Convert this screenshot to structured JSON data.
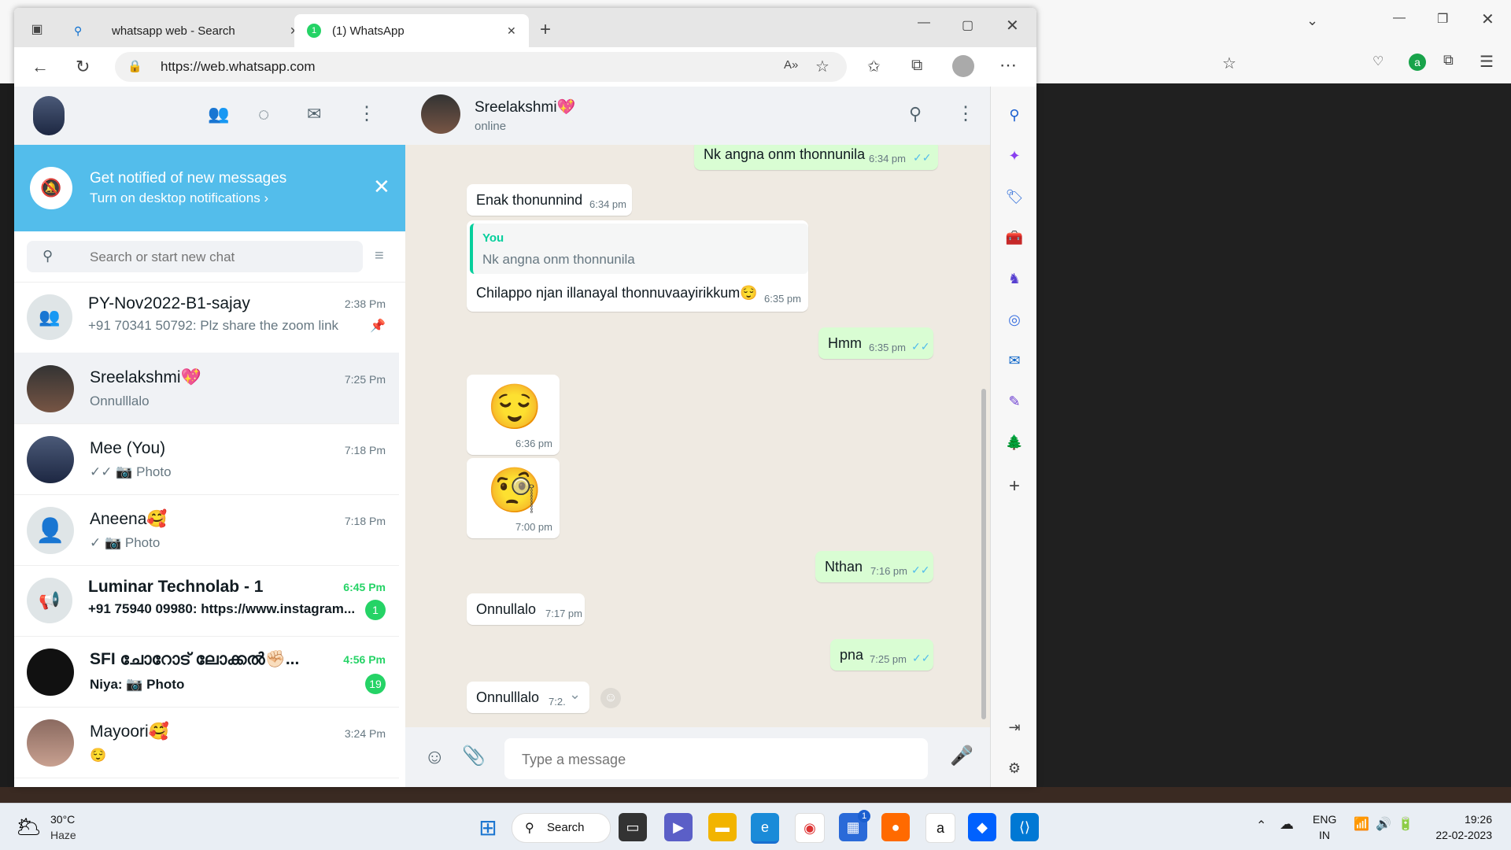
{
  "browser": {
    "tabs": [
      {
        "title": "whatsapp web - Search"
      },
      {
        "title": "(1) WhatsApp",
        "favicon_badge": "1"
      }
    ],
    "url": "https://web.whatsapp.com"
  },
  "notification": {
    "title": "Get notified of new messages",
    "subtitle": "Turn on desktop notifications ›"
  },
  "search": {
    "placeholder": "Search or start new chat"
  },
  "chats": [
    {
      "name": "PY-Nov2022-B1-sajay",
      "message": "+91 70341 50792: Plz share the zoom link",
      "time": "2:38 Pm"
    },
    {
      "name": "Sreelakshmi💖",
      "message": "Onnulllalo",
      "time": "7:25 Pm"
    },
    {
      "name": "Mee (You)",
      "message": "✓✓ 📷 Photo",
      "time": "7:18 Pm"
    },
    {
      "name": "Aneena🥰",
      "message": "✓ 📷 Photo",
      "time": "7:18 Pm"
    },
    {
      "name": "Luminar Technolab - 1",
      "message": "+91 75940 09980: https://www.instagram...",
      "time": "6:45 Pm",
      "badge": "1"
    },
    {
      "name": "SFI ചോറോട് ലോക്കൽ✊🏻...",
      "message": "Niya: 📷 Photo",
      "time": "4:56 Pm",
      "badge": "19"
    },
    {
      "name": "Mayoori🥰",
      "message": "😌",
      "time": "3:24 Pm"
    }
  ],
  "contact": {
    "name": "Sreelakshmi💖",
    "status": "online"
  },
  "messages": [
    {
      "text": "Nk angna onm thonnunila",
      "time": "6:34 pm"
    },
    {
      "text": "Enak thonunnind",
      "time": "6:34 pm"
    },
    {
      "quote_author": "You",
      "quote_text": "Nk angna onm thonnunila",
      "text": "Chilappo njan illanayal thonnuvaayirikkum😌",
      "time": "6:35 pm"
    },
    {
      "text": "Hmm",
      "time": "6:35 pm"
    },
    {
      "text": "😌",
      "time": "6:36 pm"
    },
    {
      "text": "🧐",
      "time": "7:00 pm"
    },
    {
      "text": "Nthan",
      "time": "7:16 pm"
    },
    {
      "text": "Onnullalo",
      "time": "7:17 pm"
    },
    {
      "text": "pna",
      "time": "7:25 pm"
    },
    {
      "text": "Onnulllalo",
      "time": "7:2.."
    }
  ],
  "compose": {
    "placeholder": "Type a message"
  },
  "taskbar": {
    "weather_temp": "30°C",
    "weather_desc": "Haze",
    "search_label": "Search",
    "lang": "ENG",
    "region": "IN",
    "time": "19:26",
    "date": "22-02-2023",
    "store_badge": "1"
  },
  "colors": {
    "wa_green": "#25d366",
    "notif_blue": "#53bdeb",
    "tick_blue": "#53bdeb",
    "out_bubble": "#d9fdd3"
  }
}
